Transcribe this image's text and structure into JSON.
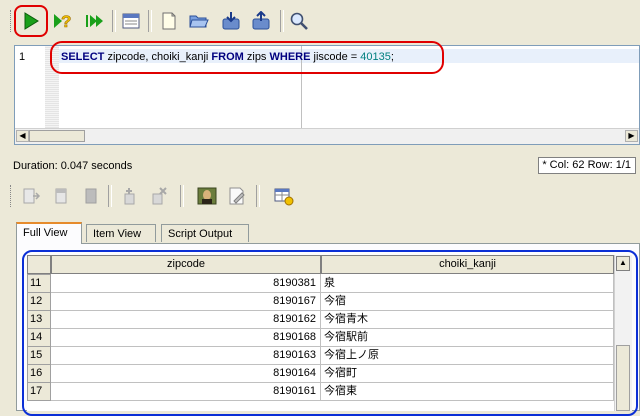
{
  "editor": {
    "line_number": "1",
    "sql": {
      "kw_select": "SELECT",
      "columns": " zipcode, choiki_kanji ",
      "kw_from": "FROM",
      "table": " zips ",
      "kw_where": "WHERE",
      "condition": " jiscode = ",
      "value": "40135",
      "terminator": ";"
    }
  },
  "status": {
    "duration": "Duration: 0.047 seconds",
    "marker": "*",
    "position": "Col: 62 Row: 1/1"
  },
  "tabs": [
    "Full View",
    "Item View",
    "Script Output"
  ],
  "results": {
    "columns": [
      "zipcode",
      "choiki_kanji"
    ],
    "rows": [
      {
        "n": "11",
        "zipcode": "8190381",
        "choiki_kanji": "泉"
      },
      {
        "n": "12",
        "zipcode": "8190167",
        "choiki_kanji": "今宿"
      },
      {
        "n": "13",
        "zipcode": "8190162",
        "choiki_kanji": "今宿青木"
      },
      {
        "n": "14",
        "zipcode": "8190168",
        "choiki_kanji": "今宿駅前"
      },
      {
        "n": "15",
        "zipcode": "8190163",
        "choiki_kanji": "今宿上ノ原"
      },
      {
        "n": "16",
        "zipcode": "8190164",
        "choiki_kanji": "今宿町"
      },
      {
        "n": "17",
        "zipcode": "8190161",
        "choiki_kanji": "今宿東"
      }
    ]
  },
  "colors": {
    "highlight_red": "#e00000",
    "highlight_blue": "#0b2fd6",
    "keyword": "#00007f",
    "number": "#007f7f"
  },
  "icons": {
    "toolbar1": [
      "run-icon",
      "explain-icon",
      "run-script-icon",
      "results-window-icon",
      "new-file-icon",
      "open-folder-icon",
      "load-icon",
      "save-icon",
      "search-icon"
    ],
    "toolbar2": [
      "export-icon",
      "first-record-icon",
      "last-record-icon",
      "insert-row-icon",
      "delete-row-icon",
      "picture-icon",
      "edit-icon",
      "grid-settings-icon"
    ]
  }
}
